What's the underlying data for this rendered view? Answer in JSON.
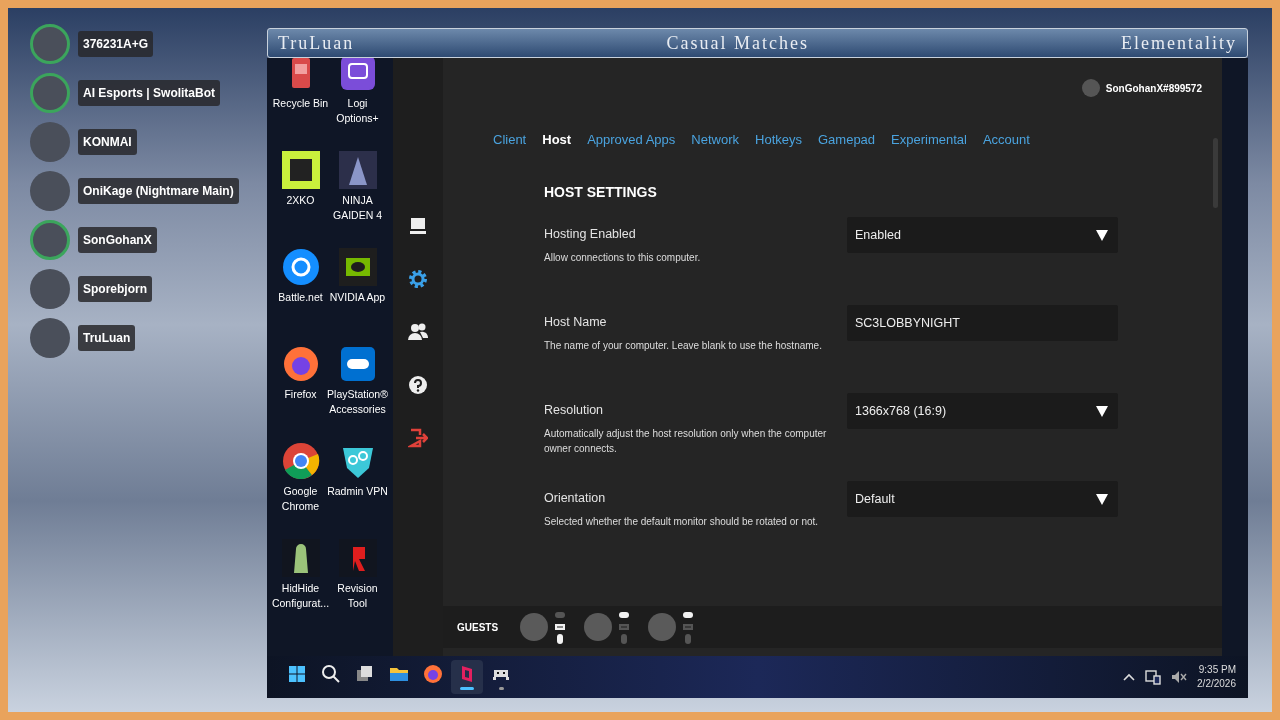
{
  "overlay_users": [
    {
      "name": "376231A+G",
      "speaking": true
    },
    {
      "name": "AI Esports | SwolitaBot",
      "speaking": true
    },
    {
      "name": "KONMAI",
      "speaking": false
    },
    {
      "name": "OniKage (Nightmare Main)",
      "speaking": false
    },
    {
      "name": "SonGohanX",
      "speaking": true
    },
    {
      "name": "Sporebjorn",
      "speaking": false
    },
    {
      "name": "TruLuan",
      "speaking": false
    }
  ],
  "header": {
    "left": "TruLuan",
    "center": "Casual Matches",
    "right": "Elementality"
  },
  "desktop_icons": [
    {
      "label": "Recycle Bin",
      "kind": "recycle"
    },
    {
      "label": "Logi Options+",
      "kind": "logi"
    },
    {
      "label": "2XKO",
      "kind": "tile-green"
    },
    {
      "label": "NINJA GAIDEN 4",
      "kind": "game"
    },
    {
      "label": "Battle.net",
      "kind": "battlenet"
    },
    {
      "label": "NVIDIA App",
      "kind": "nvidia"
    },
    {
      "label": "Firefox",
      "kind": "firefox"
    },
    {
      "label": "PlayStation® Accessories",
      "kind": "playstation"
    },
    {
      "label": "Google Chrome",
      "kind": "chrome"
    },
    {
      "label": "Radmin VPN",
      "kind": "shield"
    },
    {
      "label": "HidHide Configurat...",
      "kind": "hidhide"
    },
    {
      "label": "Revision Tool",
      "kind": "revision"
    }
  ],
  "app": {
    "user": "SonGohanX#899572",
    "sidebar": [
      {
        "kind": "computer",
        "selected": false
      },
      {
        "kind": "gear",
        "selected": true
      },
      {
        "kind": "users",
        "selected": false
      },
      {
        "kind": "help",
        "selected": false
      },
      {
        "kind": "logout",
        "selected": false
      }
    ],
    "tabs": [
      {
        "label": "Client",
        "selected": false
      },
      {
        "label": "Host",
        "selected": true
      },
      {
        "label": "Approved Apps",
        "selected": false
      },
      {
        "label": "Network",
        "selected": false
      },
      {
        "label": "Hotkeys",
        "selected": false
      },
      {
        "label": "Gamepad",
        "selected": false
      },
      {
        "label": "Experimental",
        "selected": false
      },
      {
        "label": "Account",
        "selected": false
      }
    ],
    "heading": "HOST SETTINGS",
    "settings": [
      {
        "kind": "select",
        "label": "Hosting Enabled",
        "description": "Allow connections to this computer.",
        "value": "Enabled"
      },
      {
        "kind": "text",
        "label": "Host Name",
        "description": "The name of your computer. Leave blank to use the hostname.",
        "value": "SC3LOBBYNIGHT"
      },
      {
        "kind": "select",
        "label": "Resolution",
        "description": "Automatically adjust the host resolution only when the computer owner connects.",
        "value": "1366x768 (16:9)"
      },
      {
        "kind": "select",
        "label": "Orientation",
        "description": "Selected whether the default monitor should be rotated or not.",
        "value": "Default"
      }
    ],
    "guests_label": "GUESTS",
    "guests": [
      {
        "gamepad": false,
        "keyboard": true,
        "mouse": true
      },
      {
        "gamepad": true,
        "keyboard": false,
        "mouse": false
      },
      {
        "gamepad": true,
        "keyboard": false,
        "mouse": false
      }
    ]
  },
  "taskbar": {
    "apps": [
      {
        "kind": "start",
        "selected": false,
        "running": false
      },
      {
        "kind": "search",
        "selected": false,
        "running": false
      },
      {
        "kind": "taskview",
        "selected": false,
        "running": false
      },
      {
        "kind": "explorer",
        "selected": false,
        "running": false
      },
      {
        "kind": "firefox",
        "selected": false,
        "running": false
      },
      {
        "kind": "parsec",
        "selected": true,
        "running": true
      },
      {
        "kind": "app",
        "selected": false,
        "running": true
      }
    ],
    "time": "9:35 PM",
    "date": "2/2/2026"
  }
}
